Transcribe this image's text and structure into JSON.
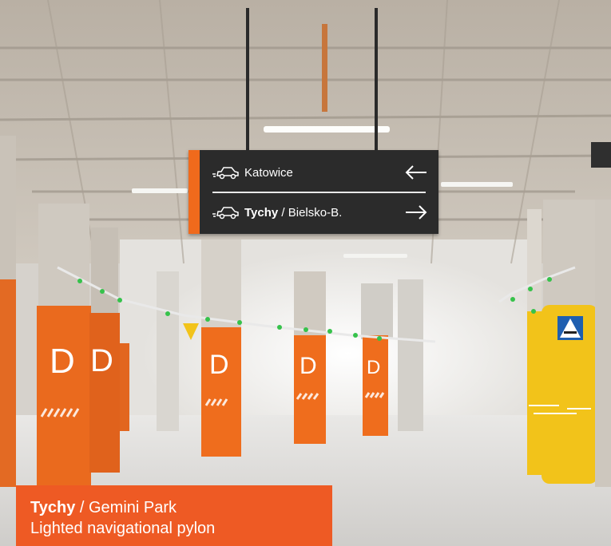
{
  "sign": {
    "row1": {
      "destination": "Katowice",
      "arrow": "left-arrow-icon",
      "icon": "car-icon"
    },
    "row2": {
      "destination_bold": "Tychy",
      "destination_rest": " / Bielsko-B.",
      "arrow": "right-arrow-icon",
      "icon": "car-icon"
    }
  },
  "pillars": {
    "letter": "D"
  },
  "caption": {
    "line1_bold": "Tychy",
    "line1_rest": " / Gemini Park",
    "line2": "Lighted navigational pylon"
  },
  "colors": {
    "orange": "#f06a1c",
    "yellow": "#f2c31a",
    "sign_dark": "#2b2b2b",
    "caption_orange": "#ee5a24"
  }
}
